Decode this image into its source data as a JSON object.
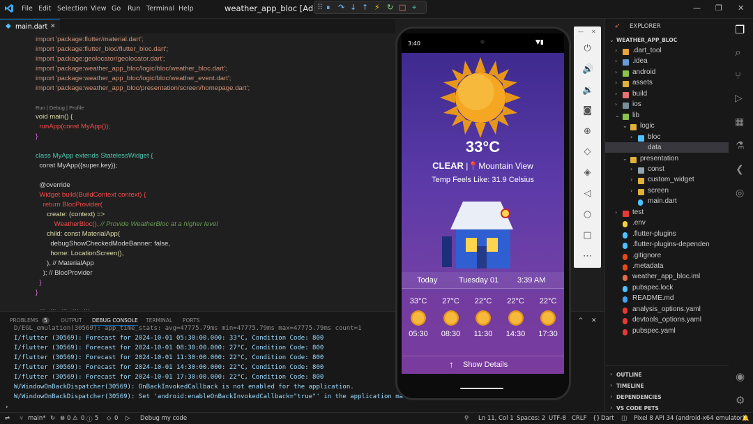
{
  "titlebar": {
    "menus": [
      "File",
      "Edit",
      "Selection",
      "View",
      "Go",
      "Run",
      "Terminal",
      "Help"
    ],
    "title": "weather_app_bloc [Adr"
  },
  "editor": {
    "tab": "main.dart",
    "codelens": "Run | Debug | Profile"
  },
  "code": [
    {
      "t": "import 'package:flutter/material.dart';"
    },
    {
      "t": "import 'package:flutter_bloc/flutter_bloc.dart';"
    },
    {
      "t": "import 'package:geolocator/geolocator.dart';"
    },
    {
      "t": "import 'package:weather_app_bloc/logic/bloc/weather_bloc.dart';"
    },
    {
      "t": "import 'package:weather_app_bloc/logic/bloc/weather_event.dart';"
    },
    {
      "t": "import 'package:weather_app_bloc/presentation/screen/homepage.dart';"
    }
  ],
  "code2": {
    "l1": "void main() {",
    "l2": "  runApp(const MyApp());",
    "l3": "}",
    "l4": "class MyApp extends StatelessWidget {",
    "l5": "  const MyApp({super.key});",
    "l6": "  @override",
    "l7": "  Widget build(BuildContext context) {",
    "l8": "    return BlocProvider(",
    "l9": "      create: (context) =>",
    "l10": "          WeatherBloc(), ",
    "l10c": "// Provide WeatherBloc at a higher level",
    "l11": "      child: const MaterialApp(",
    "l12": "        debugShowCheckedModeBanner: false,",
    "l13": "        home: LocationScreen(),",
    "l14": "      ), // MaterialApp",
    "l15": "    ); // BlocProvider",
    "l16": "  }",
    "l17": "}",
    "l18": "  ...   ...   ...   ...   ..."
  },
  "panel": {
    "tabs": [
      "PROBLEMS",
      "OUTPUT",
      "DEBUG CONSOLE",
      "TERMINAL",
      "PORTS"
    ],
    "problems_count": "5",
    "logs": [
      "D/EGL_emulation(30569): app_time_stats: avg=47775.79ms min=47775.79ms max=47775.79ms count=1",
      "I/flutter (30569): Forecast for 2024-10-01 05:30:00.000: 33°C, Condition Code: 800",
      "I/flutter (30569): Forecast for 2024-10-01 08:30:00.000: 27°C, Condition Code: 800",
      "I/flutter (30569): Forecast for 2024-10-01 11:30:00.000: 22°C, Condition Code: 800",
      "I/flutter (30569): Forecast for 2024-10-01 14:30:00.000: 22°C, Condition Code: 800",
      "I/flutter (30569): Forecast for 2024-10-01 17:30:00.000: 22°C, Condition Code: 800",
      "W/WindowOnBackDispatcher(30569): OnBackInvokedCallback is not enabled for the application.",
      "W/WindowOnBackDispatcher(30569): Set 'android:enableOnBackInvokedCallback=\"true\"' in the application ma"
    ]
  },
  "explorer": {
    "header": "EXPLORER",
    "root": "WEATHER_APP_BLOC",
    "items": [
      ".dart_tool",
      ".idea",
      "android",
      "assets",
      "build",
      "ios",
      "lib",
      "logic",
      "bloc",
      "data",
      "presentation",
      "const",
      "custom_widget",
      "screen",
      "main.dart",
      "test",
      ".env",
      ".flutter-plugins",
      ".flutter-plugins-dependen",
      ".gitignore",
      ".metadata",
      "weather_app_bloc.iml",
      "pubspec.lock",
      "README.md",
      "analysis_options.yaml",
      "devtools_options.yaml",
      "pubspec.yaml"
    ],
    "sections": [
      "OUTLINE",
      "TIMELINE",
      "DEPENDENCIES",
      "VS CODE PETS"
    ]
  },
  "phone": {
    "time": "3:40",
    "temp": "33°C",
    "condition": "CLEAR",
    "location": "Mountain View",
    "feels": "Temp Feels Like: 31.9 Celsius",
    "day_label": "Today",
    "date": "Tuesday 01",
    "clock": "3:39 AM",
    "forecast": [
      {
        "t": "33°C",
        "h": "05:30"
      },
      {
        "t": "27°C",
        "h": "08:30"
      },
      {
        "t": "22°C",
        "h": "11:30"
      },
      {
        "t": "22°C",
        "h": "14:30"
      },
      {
        "t": "22°C",
        "h": "17:30"
      }
    ],
    "details": "Show Details"
  },
  "status": {
    "branch": "main*",
    "errors": "0",
    "warnings": "0",
    "info": "0",
    "ports": "5",
    "signal": "0",
    "debug": "Debug my code",
    "pos": "Ln 11, Col 1",
    "spaces": "Spaces: 2",
    "enc": "UTF-8",
    "eol": "CRLF",
    "lang": "Dart",
    "device": "Pixel 8 API 34 (android-x64 emulator)"
  },
  "colors": {
    "accent": "#0078d4",
    "sun": "#f5a623",
    "screen_top": "#3e2a8f",
    "screen_bottom": "#7a3b9c"
  }
}
